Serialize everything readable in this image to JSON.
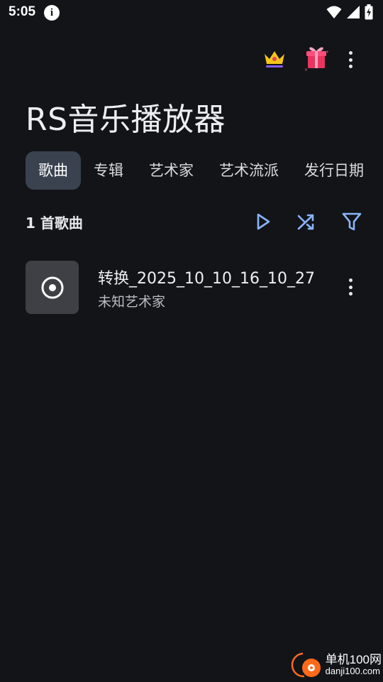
{
  "status_bar": {
    "time": "5:05",
    "info_glyph": "i",
    "icons": [
      "info-icon",
      "wifi-icon",
      "signal-icon",
      "battery-charging-icon"
    ]
  },
  "top_actions": {
    "icons": [
      "crown-icon",
      "gift-icon",
      "more-vertical-icon"
    ]
  },
  "app": {
    "title": "RS音乐播放器"
  },
  "tabs": [
    {
      "label": "歌曲",
      "active": true
    },
    {
      "label": "专辑",
      "active": false
    },
    {
      "label": "艺术家",
      "active": false
    },
    {
      "label": "艺术流派",
      "active": false
    },
    {
      "label": "发行日期",
      "active": false
    }
  ],
  "list_header": {
    "count_label": "1 首歌曲",
    "actions": [
      "play-icon",
      "shuffle-icon",
      "filter-icon"
    ]
  },
  "songs": [
    {
      "title": "转换_2025_10_10_16_10_27",
      "artist": "未知艺术家",
      "art_icon": "disc-icon"
    }
  ],
  "watermark": {
    "title": "单机100网",
    "url": "danji100.com"
  },
  "colors": {
    "background": "#121418",
    "tab_active_bg": "#3a4250",
    "accent_blue": "#8ab4f8"
  }
}
